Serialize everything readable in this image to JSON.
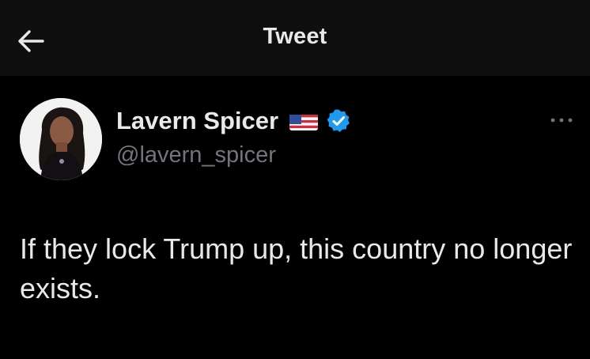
{
  "header": {
    "back_icon": "arrow-left-icon",
    "title": "Tweet"
  },
  "tweet": {
    "author": {
      "display_name": "Lavern Spicer",
      "flag_icon": "us-flag-icon",
      "verified_icon": "verified-badge-icon",
      "handle": "@lavern_spicer",
      "avatar_icon": "profile-photo"
    },
    "more_icon": "more-horizontal-icon",
    "text": "If they lock Trump up, this country no longer exists."
  },
  "colors": {
    "background": "#000000",
    "header_background": "#0f0f10",
    "primary_text": "#e7e9ea",
    "secondary_text": "#71767b",
    "verified_blue": "#1d9bf0"
  }
}
